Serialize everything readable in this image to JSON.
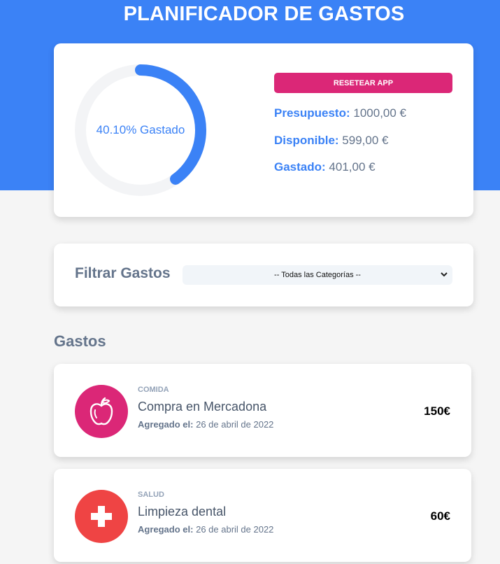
{
  "header": {
    "title": "PLANIFICADOR DE GASTOS"
  },
  "budget": {
    "progress_text": "40.10% Gastado",
    "progress_fraction": 0.401,
    "reset_label": "RESETEAR APP",
    "presupuesto_label": "Presupuesto:",
    "presupuesto_value": "1000,00 €",
    "disponible_label": "Disponible:",
    "disponible_value": "599,00 €",
    "gastado_label": "Gastado:",
    "gastado_value": "401,00 €"
  },
  "filter": {
    "label": "Filtrar Gastos",
    "selected": "-- Todas las Categorías --"
  },
  "expenses_section": {
    "title": "Gastos",
    "items": [
      {
        "category": "COMIDA",
        "name": "Compra en Mercadona",
        "date_label": "Agregado el:",
        "date": "26 de abril de 2022",
        "amount": "150€",
        "icon": "apple-icon"
      },
      {
        "category": "SALUD",
        "name": "Limpieza dental",
        "date_label": "Agregado el:",
        "date": "26 de abril de 2022",
        "amount": "60€",
        "icon": "health-cross-icon"
      }
    ]
  },
  "colors": {
    "primary": "#3b82f6",
    "accent": "#db2777",
    "health": "#ef4444",
    "background": "#f5f5f5"
  }
}
